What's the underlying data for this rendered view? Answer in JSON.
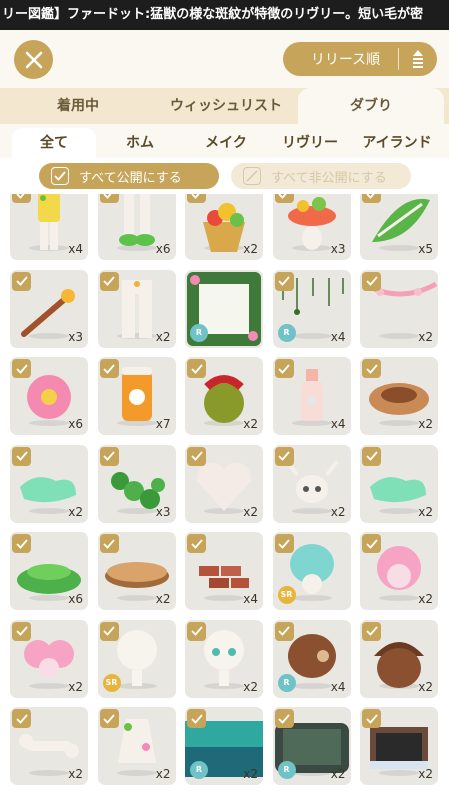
{
  "ticker": "リー図鑑】ファードット:猛獣の様な斑紋が特徴のリヴリー。短い毛が密",
  "sort_label": "リリース順",
  "tabs": [
    {
      "label": "着用中",
      "active": false
    },
    {
      "label": "ウィッシュリスト",
      "active": false
    },
    {
      "label": "ダブり",
      "active": true
    }
  ],
  "subtabs": [
    {
      "label": "全て",
      "active": true
    },
    {
      "label": "ホム",
      "active": false
    },
    {
      "label": "メイク",
      "active": false
    },
    {
      "label": "リヴリー",
      "active": false
    },
    {
      "label": "アイランド",
      "active": false
    }
  ],
  "actions": {
    "publish_all": "すべて公開にする",
    "unpublish_all": "すべて非公開にする"
  },
  "colors": {
    "gold": "#c6a459",
    "rarity_r": "#6fc3c6",
    "rarity_sr": "#e8b43c"
  },
  "items": [
    {
      "icon": "yellow-outfit-icon",
      "qty": "x4",
      "rarity": "",
      "checked": true
    },
    {
      "icon": "white-boots-icon",
      "qty": "x6",
      "rarity": "",
      "checked": true
    },
    {
      "icon": "fruit-basket-icon",
      "qty": "x2",
      "rarity": "",
      "checked": true
    },
    {
      "icon": "fruit-hat-icon",
      "qty": "x3",
      "rarity": "",
      "checked": true
    },
    {
      "icon": "leaf-wrap-icon",
      "qty": "x5",
      "rarity": "",
      "checked": true
    },
    {
      "icon": "torch-icon",
      "qty": "x3",
      "rarity": "",
      "checked": true
    },
    {
      "icon": "white-leggings-icon",
      "qty": "x2",
      "rarity": "",
      "checked": true
    },
    {
      "icon": "flower-frame-icon",
      "qty": "",
      "rarity": "R",
      "checked": false
    },
    {
      "icon": "hanging-vines-icon",
      "qty": "x4",
      "rarity": "R",
      "checked": true
    },
    {
      "icon": "pink-garland-icon",
      "qty": "x2",
      "rarity": "",
      "checked": true
    },
    {
      "icon": "pink-flower-icon",
      "qty": "x6",
      "rarity": "",
      "checked": true
    },
    {
      "icon": "orange-jar-icon",
      "qty": "x7",
      "rarity": "",
      "checked": true
    },
    {
      "icon": "gift-fruit-icon",
      "qty": "x2",
      "rarity": "",
      "checked": true
    },
    {
      "icon": "potion-bottle-icon",
      "qty": "x4",
      "rarity": "",
      "checked": true
    },
    {
      "icon": "bird-nest-icon",
      "qty": "x2",
      "rarity": "",
      "checked": true
    },
    {
      "icon": "green-puddle-icon",
      "qty": "x2",
      "rarity": "",
      "checked": true
    },
    {
      "icon": "clover-patch-icon",
      "qty": "x3",
      "rarity": "",
      "checked": true
    },
    {
      "icon": "heart-rock-icon",
      "qty": "x2",
      "rarity": "",
      "checked": true
    },
    {
      "icon": "deer-skull-icon",
      "qty": "x2",
      "rarity": "",
      "checked": true
    },
    {
      "icon": "green-puddle-icon",
      "qty": "x2",
      "rarity": "",
      "checked": true
    },
    {
      "icon": "grass-mound-icon",
      "qty": "x6",
      "rarity": "",
      "checked": true
    },
    {
      "icon": "tree-stump-icon",
      "qty": "x2",
      "rarity": "",
      "checked": true
    },
    {
      "icon": "brick-pile-icon",
      "qty": "x4",
      "rarity": "",
      "checked": true
    },
    {
      "icon": "teal-hair-icon",
      "qty": "",
      "rarity": "SR",
      "checked": true
    },
    {
      "icon": "pink-hair-icon",
      "qty": "x2",
      "rarity": "",
      "checked": true
    },
    {
      "icon": "pink-curls-icon",
      "qty": "x2",
      "rarity": "",
      "checked": true
    },
    {
      "icon": "doll-head-icon",
      "qty": "",
      "rarity": "SR",
      "checked": true
    },
    {
      "icon": "doll-face-icon",
      "qty": "x2",
      "rarity": "",
      "checked": true
    },
    {
      "icon": "acorn-hat-icon",
      "qty": "x4",
      "rarity": "R",
      "checked": true
    },
    {
      "icon": "acorn-icon",
      "qty": "x2",
      "rarity": "",
      "checked": true
    },
    {
      "icon": "bone-icon",
      "qty": "x2",
      "rarity": "",
      "checked": true
    },
    {
      "icon": "flower-dress-icon",
      "qty": "x2",
      "rarity": "",
      "checked": true
    },
    {
      "icon": "teal-pond-icon",
      "qty": "x2",
      "rarity": "R",
      "checked": true
    },
    {
      "icon": "dark-pond-icon",
      "qty": "x2",
      "rarity": "R",
      "checked": true
    },
    {
      "icon": "wood-box-icon",
      "qty": "x2",
      "rarity": "",
      "checked": true
    }
  ]
}
